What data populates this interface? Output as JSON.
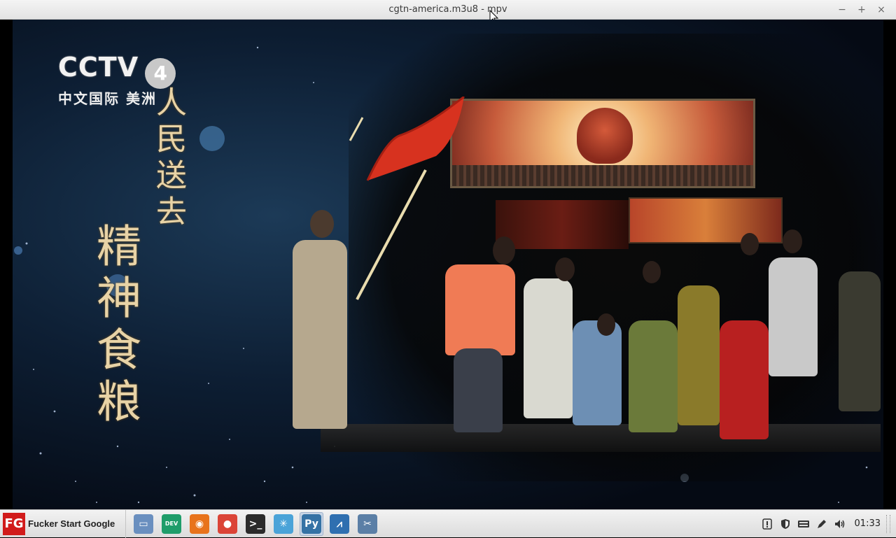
{
  "window": {
    "title": "cgtn-america.m3u8 - mpv",
    "minimize_glyph": "−",
    "maximize_glyph": "+",
    "close_glyph": "×"
  },
  "video": {
    "channel_logo": {
      "brand": "CCTV",
      "number": "4",
      "subtitle": "中文国际 美洲"
    },
    "caption_small": "人民送去",
    "caption_large": "精神食粮"
  },
  "taskbar": {
    "start_logo": "FG",
    "start_label": "Fucker Start Google",
    "launchers": [
      {
        "name": "file-manager-icon",
        "color": "#6a8fbf",
        "glyph": "▭"
      },
      {
        "name": "edge-dev-icon",
        "color": "#1f9d6a",
        "glyph": "DEV"
      },
      {
        "name": "firefox-icon",
        "color": "#e8731c",
        "glyph": "◉"
      },
      {
        "name": "chrome-icon",
        "color": "#db4437",
        "glyph": "●"
      },
      {
        "name": "terminal-icon",
        "color": "#2b2b2b",
        "glyph": ">_"
      },
      {
        "name": "settings-snowflake-icon",
        "color": "#4aa3d8",
        "glyph": "✳"
      },
      {
        "name": "python-icon",
        "color": "#3572a5",
        "glyph": "Py"
      },
      {
        "name": "system-monitor-icon",
        "color": "#2f6fb0",
        "glyph": "⩘"
      },
      {
        "name": "tool-icon",
        "color": "#5b7fa6",
        "glyph": "✂"
      }
    ],
    "tray": {
      "clock": "01:33"
    }
  }
}
